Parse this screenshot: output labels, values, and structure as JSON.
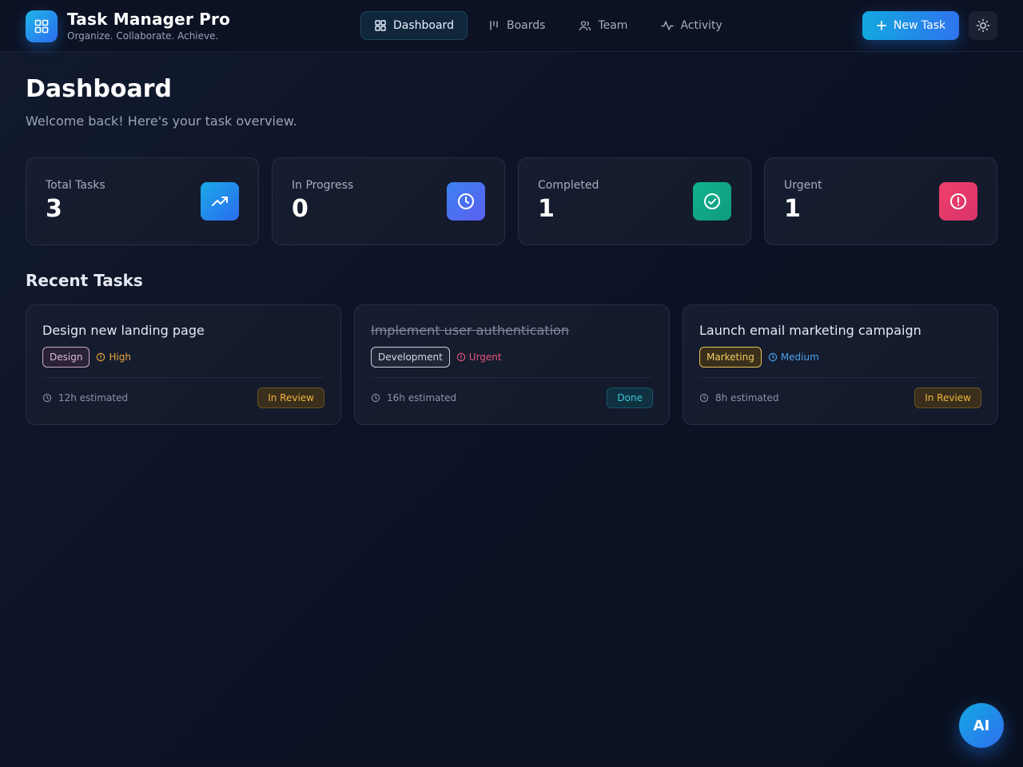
{
  "app": {
    "title": "Task Manager Pro",
    "tagline": "Organize. Collaborate. Achieve."
  },
  "nav": {
    "items": [
      {
        "label": "Dashboard",
        "icon": "grid-icon",
        "active": true
      },
      {
        "label": "Boards",
        "icon": "columns-icon",
        "active": false
      },
      {
        "label": "Team",
        "icon": "users-icon",
        "active": false
      },
      {
        "label": "Activity",
        "icon": "activity-icon",
        "active": false
      }
    ]
  },
  "header": {
    "new_task_label": "New Task",
    "theme_icon": "sun-icon"
  },
  "page": {
    "title": "Dashboard",
    "subtitle": "Welcome back! Here's your task overview."
  },
  "stats": [
    {
      "label": "Total Tasks",
      "value": "3",
      "icon": "trending-up-icon",
      "color": "#1e9ee8"
    },
    {
      "label": "In Progress",
      "value": "0",
      "icon": "clock-icon",
      "color": "#4f6ef0"
    },
    {
      "label": "Completed",
      "value": "1",
      "icon": "check-circle-icon",
      "color": "#12a887"
    },
    {
      "label": "Urgent",
      "value": "1",
      "icon": "alert-circle-icon",
      "color": "#e83a6c"
    }
  ],
  "recent": {
    "title": "Recent Tasks",
    "tasks": [
      {
        "title": "Design new landing page",
        "tag": "Design",
        "priority": "High",
        "estimate": "12h estimated",
        "status": "In Review",
        "done": false
      },
      {
        "title": "Implement user authentication",
        "tag": "Development",
        "priority": "Urgent",
        "estimate": "16h estimated",
        "status": "Done",
        "done": true
      },
      {
        "title": "Launch email marketing campaign",
        "tag": "Marketing",
        "priority": "Medium",
        "estimate": "8h estimated",
        "status": "In Review",
        "done": false
      }
    ]
  },
  "colors": {
    "priority_high": "#e8a93a",
    "priority_urgent": "#e8557a",
    "priority_medium": "#4aa0e8",
    "tag_design": "#c9a9c4",
    "tag_development": "#c9cfdb",
    "tag_marketing": "#e8c25a"
  },
  "ai_button": {
    "label": "AI"
  }
}
